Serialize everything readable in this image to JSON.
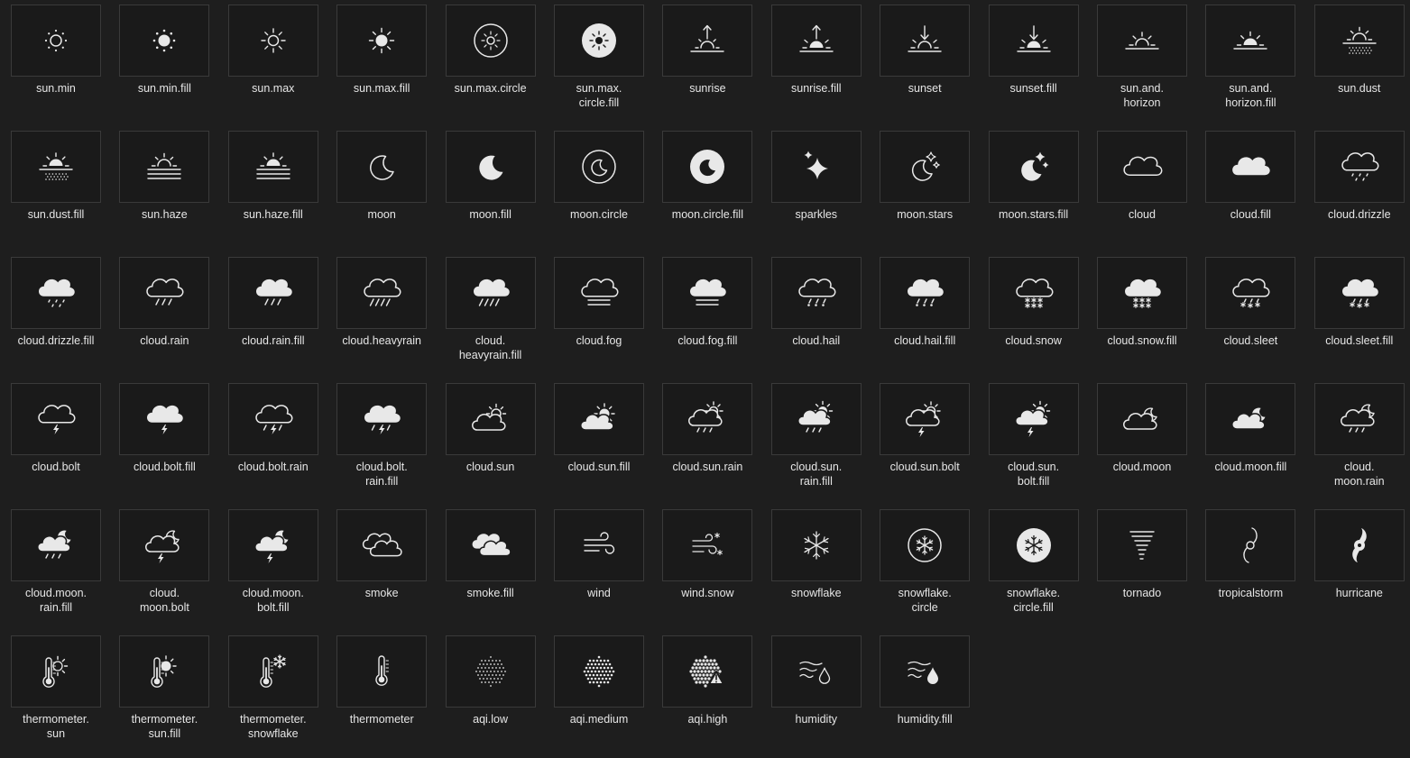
{
  "window": {
    "background": "#1e1e1e",
    "tile_background": "#1a1a1a",
    "tile_border": "#3a3a3a",
    "icon_color": "#e8e8e8",
    "label_color": "#e6e6e6"
  },
  "icons": [
    {
      "label": "sun.min",
      "icon": "sun-min-icon"
    },
    {
      "label": "sun.min.fill",
      "icon": "sun-min-fill-icon"
    },
    {
      "label": "sun.max",
      "icon": "sun-max-icon"
    },
    {
      "label": "sun.max.fill",
      "icon": "sun-max-fill-icon"
    },
    {
      "label": "sun.max.circle",
      "icon": "sun-max-circle-icon"
    },
    {
      "label": "sun.max.\ncircle.fill",
      "icon": "sun-max-circle-fill-icon"
    },
    {
      "label": "sunrise",
      "icon": "sunrise-icon"
    },
    {
      "label": "sunrise.fill",
      "icon": "sunrise-fill-icon"
    },
    {
      "label": "sunset",
      "icon": "sunset-icon"
    },
    {
      "label": "sunset.fill",
      "icon": "sunset-fill-icon"
    },
    {
      "label": "sun.and.\nhorizon",
      "icon": "sun-and-horizon-icon"
    },
    {
      "label": "sun.and.\nhorizon.fill",
      "icon": "sun-and-horizon-fill-icon"
    },
    {
      "label": "sun.dust",
      "icon": "sun-dust-icon"
    },
    {
      "label": "sun.dust.fill",
      "icon": "sun-dust-fill-icon"
    },
    {
      "label": "sun.haze",
      "icon": "sun-haze-icon"
    },
    {
      "label": "sun.haze.fill",
      "icon": "sun-haze-fill-icon"
    },
    {
      "label": "moon",
      "icon": "moon-icon"
    },
    {
      "label": "moon.fill",
      "icon": "moon-fill-icon"
    },
    {
      "label": "moon.circle",
      "icon": "moon-circle-icon"
    },
    {
      "label": "moon.circle.fill",
      "icon": "moon-circle-fill-icon"
    },
    {
      "label": "sparkles",
      "icon": "sparkles-icon"
    },
    {
      "label": "moon.stars",
      "icon": "moon-stars-icon"
    },
    {
      "label": "moon.stars.fill",
      "icon": "moon-stars-fill-icon"
    },
    {
      "label": "cloud",
      "icon": "cloud-icon"
    },
    {
      "label": "cloud.fill",
      "icon": "cloud-fill-icon"
    },
    {
      "label": "cloud.drizzle",
      "icon": "cloud-drizzle-icon"
    },
    {
      "label": "cloud.drizzle.fill",
      "icon": "cloud-drizzle-fill-icon"
    },
    {
      "label": "cloud.rain",
      "icon": "cloud-rain-icon"
    },
    {
      "label": "cloud.rain.fill",
      "icon": "cloud-rain-fill-icon"
    },
    {
      "label": "cloud.heavyrain",
      "icon": "cloud-heavyrain-icon"
    },
    {
      "label": "cloud.\nheavyrain.fill",
      "icon": "cloud-heavyrain-fill-icon"
    },
    {
      "label": "cloud.fog",
      "icon": "cloud-fog-icon"
    },
    {
      "label": "cloud.fog.fill",
      "icon": "cloud-fog-fill-icon"
    },
    {
      "label": "cloud.hail",
      "icon": "cloud-hail-icon"
    },
    {
      "label": "cloud.hail.fill",
      "icon": "cloud-hail-fill-icon"
    },
    {
      "label": "cloud.snow",
      "icon": "cloud-snow-icon"
    },
    {
      "label": "cloud.snow.fill",
      "icon": "cloud-snow-fill-icon"
    },
    {
      "label": "cloud.sleet",
      "icon": "cloud-sleet-icon"
    },
    {
      "label": "cloud.sleet.fill",
      "icon": "cloud-sleet-fill-icon"
    },
    {
      "label": "cloud.bolt",
      "icon": "cloud-bolt-icon"
    },
    {
      "label": "cloud.bolt.fill",
      "icon": "cloud-bolt-fill-icon"
    },
    {
      "label": "cloud.bolt.rain",
      "icon": "cloud-bolt-rain-icon"
    },
    {
      "label": "cloud.bolt.\nrain.fill",
      "icon": "cloud-bolt-rain-fill-icon"
    },
    {
      "label": "cloud.sun",
      "icon": "cloud-sun-icon"
    },
    {
      "label": "cloud.sun.fill",
      "icon": "cloud-sun-fill-icon"
    },
    {
      "label": "cloud.sun.rain",
      "icon": "cloud-sun-rain-icon"
    },
    {
      "label": "cloud.sun.\nrain.fill",
      "icon": "cloud-sun-rain-fill-icon"
    },
    {
      "label": "cloud.sun.bolt",
      "icon": "cloud-sun-bolt-icon"
    },
    {
      "label": "cloud.sun.\nbolt.fill",
      "icon": "cloud-sun-bolt-fill-icon"
    },
    {
      "label": "cloud.moon",
      "icon": "cloud-moon-icon"
    },
    {
      "label": "cloud.moon.fill",
      "icon": "cloud-moon-fill-icon"
    },
    {
      "label": "cloud.\nmoon.rain",
      "icon": "cloud-moon-rain-icon"
    },
    {
      "label": "cloud.moon.\nrain.fill",
      "icon": "cloud-moon-rain-fill-icon"
    },
    {
      "label": "cloud.\nmoon.bolt",
      "icon": "cloud-moon-bolt-icon"
    },
    {
      "label": "cloud.moon.\nbolt.fill",
      "icon": "cloud-moon-bolt-fill-icon"
    },
    {
      "label": "smoke",
      "icon": "smoke-icon"
    },
    {
      "label": "smoke.fill",
      "icon": "smoke-fill-icon"
    },
    {
      "label": "wind",
      "icon": "wind-icon"
    },
    {
      "label": "wind.snow",
      "icon": "wind-snow-icon"
    },
    {
      "label": "snowflake",
      "icon": "snowflake-icon"
    },
    {
      "label": "snowflake.\ncircle",
      "icon": "snowflake-circle-icon"
    },
    {
      "label": "snowflake.\ncircle.fill",
      "icon": "snowflake-circle-fill-icon"
    },
    {
      "label": "tornado",
      "icon": "tornado-icon"
    },
    {
      "label": "tropicalstorm",
      "icon": "tropicalstorm-icon"
    },
    {
      "label": "hurricane",
      "icon": "hurricane-icon"
    },
    {
      "label": "thermometer.\nsun",
      "icon": "thermometer-sun-icon"
    },
    {
      "label": "thermometer.\nsun.fill",
      "icon": "thermometer-sun-fill-icon"
    },
    {
      "label": "thermometer.\nsnowflake",
      "icon": "thermometer-snowflake-icon"
    },
    {
      "label": "thermometer",
      "icon": "thermometer-icon"
    },
    {
      "label": "aqi.low",
      "icon": "aqi-low-icon"
    },
    {
      "label": "aqi.medium",
      "icon": "aqi-medium-icon"
    },
    {
      "label": "aqi.high",
      "icon": "aqi-high-icon"
    },
    {
      "label": "humidity",
      "icon": "humidity-icon"
    },
    {
      "label": "humidity.fill",
      "icon": "humidity-fill-icon"
    }
  ]
}
